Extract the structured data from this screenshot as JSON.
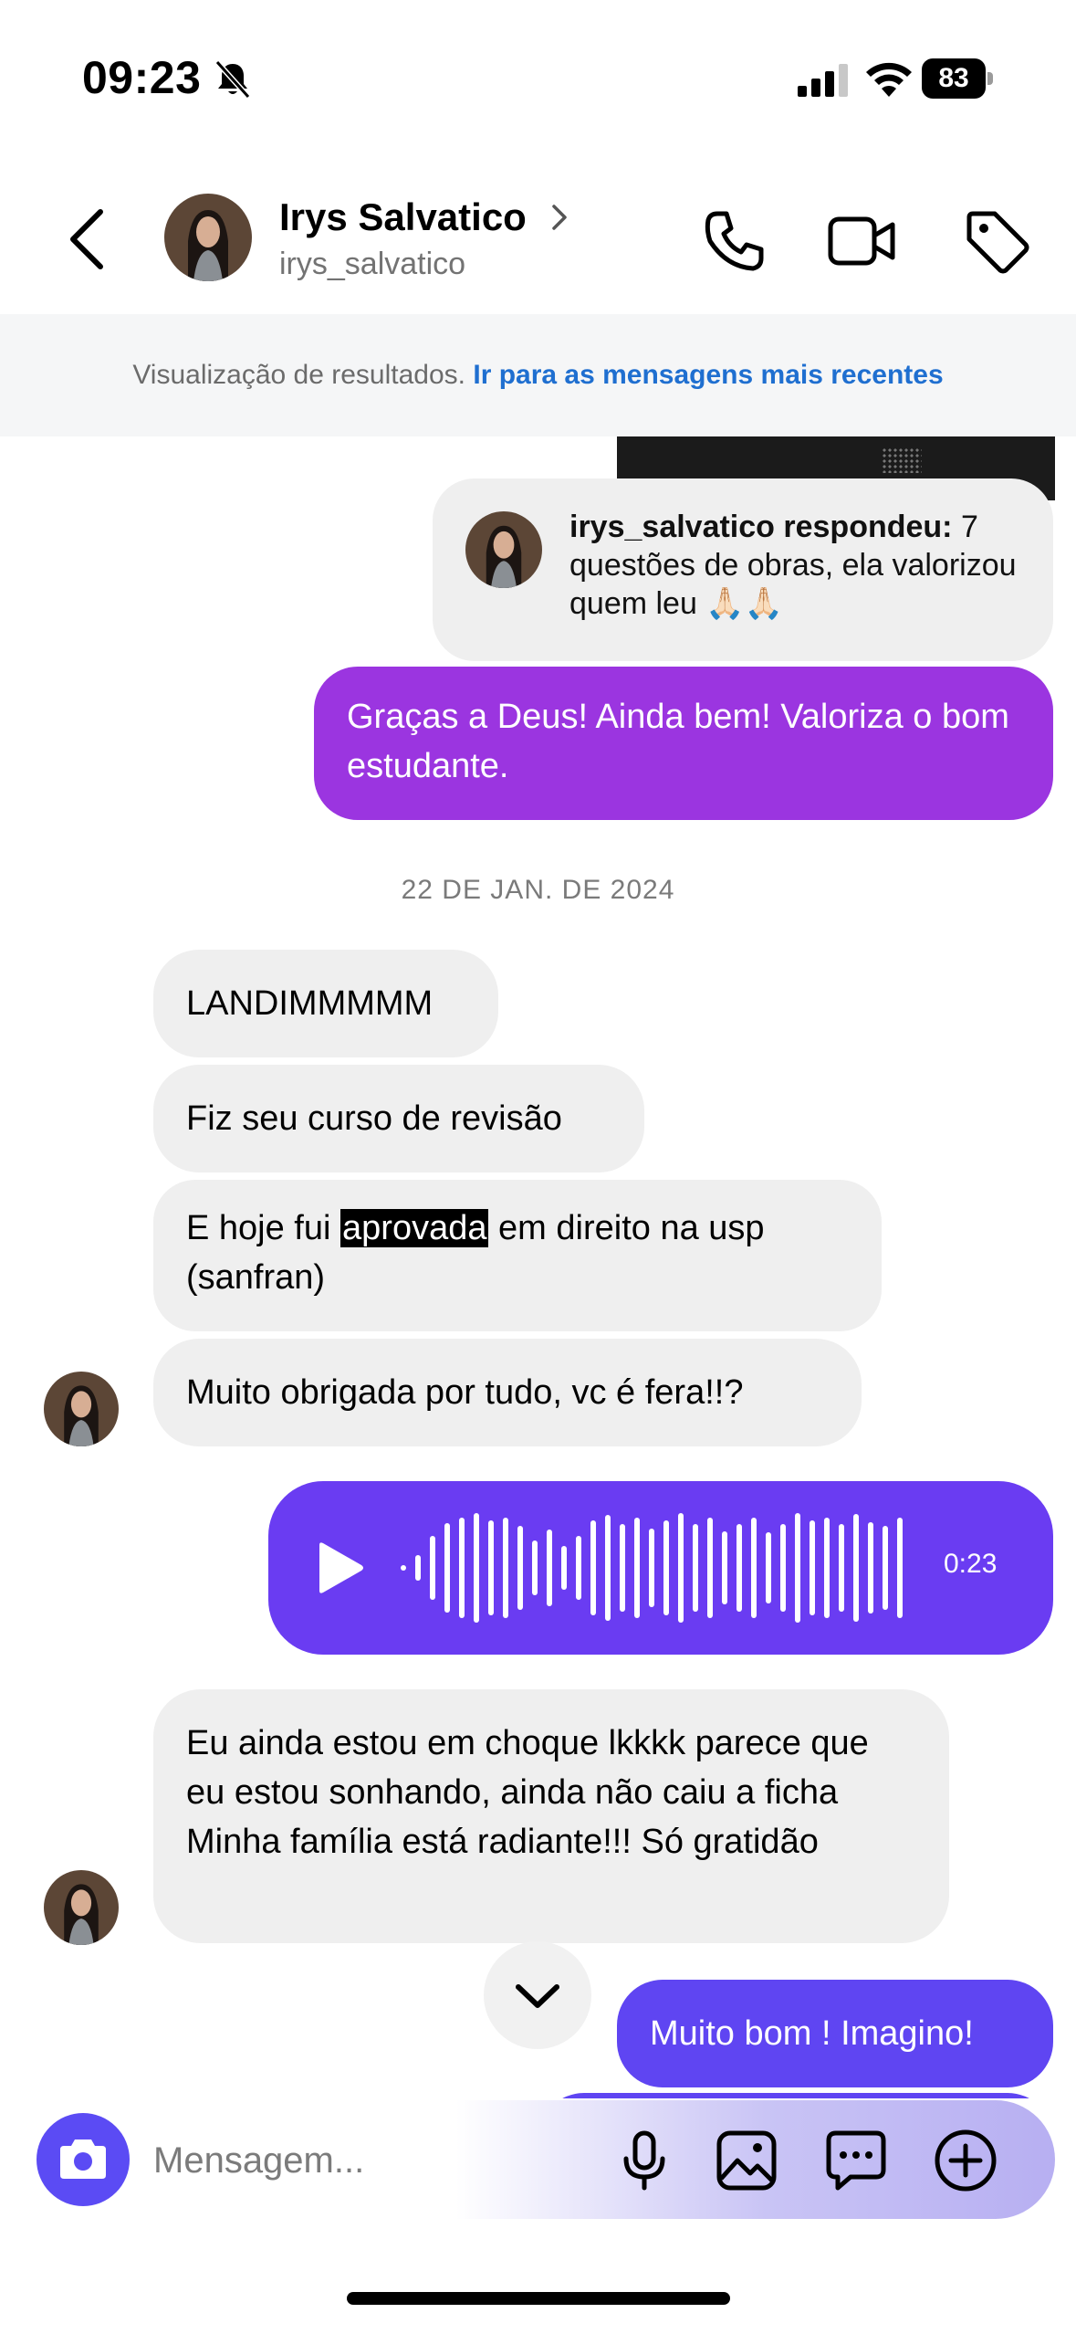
{
  "status_bar": {
    "time": "09:23",
    "battery": "83"
  },
  "header": {
    "name": "Irys Salvatico",
    "username": "irys_salvatico"
  },
  "banner": {
    "text": "Visualização de resultados.",
    "link": "Ir para as mensagens mais recentes"
  },
  "reply_card": {
    "author": "irys_salvatico respondeu:",
    "text": "7 questões de obras, ela valorizou quem leu 🙏🏻🙏🏻"
  },
  "messages": [
    {
      "side": "out",
      "text": "Graças a Deus! Ainda bem! Valoriza o bom estudante."
    },
    {
      "side": "in",
      "text": "LANDIMMMMM"
    },
    {
      "side": "in",
      "text": "Fiz seu curso de revisão"
    },
    {
      "side": "in",
      "text_before": "E hoje fui",
      "highlight": "aprovada",
      "text_after": "em direito na usp (sanfran)"
    },
    {
      "side": "in",
      "text": "Muito obrigada por tudo, vc é fera!!?"
    },
    {
      "side": "out",
      "type": "voice",
      "duration": "0:23"
    },
    {
      "side": "in",
      "line1": "Eu ainda estou em choque lkkkk parece que eu estou sonhando, ainda não caiu a ficha",
      "line2": "Minha família está radiante!!! Só gratidão"
    },
    {
      "side": "out",
      "text": "Muito bom ! Imagino!"
    }
  ],
  "date_separator": "22 DE JAN. DE 2024",
  "composer": {
    "placeholder": "Mensagem..."
  },
  "colors": {
    "purple_bubble": "#9b35e0",
    "violet_bubble": "#5f45f2",
    "voice_bubble": "#6a3cf2",
    "link_blue": "#1f6fd0"
  },
  "icons": [
    "bell-slash-icon",
    "signal-icon",
    "wifi-icon",
    "back-icon",
    "chevron-right-icon",
    "phone-icon",
    "video-icon",
    "tag-icon",
    "play-icon",
    "chevron-down-icon",
    "camera-icon",
    "microphone-icon",
    "gallery-icon",
    "sticker-icon",
    "plus-icon"
  ]
}
